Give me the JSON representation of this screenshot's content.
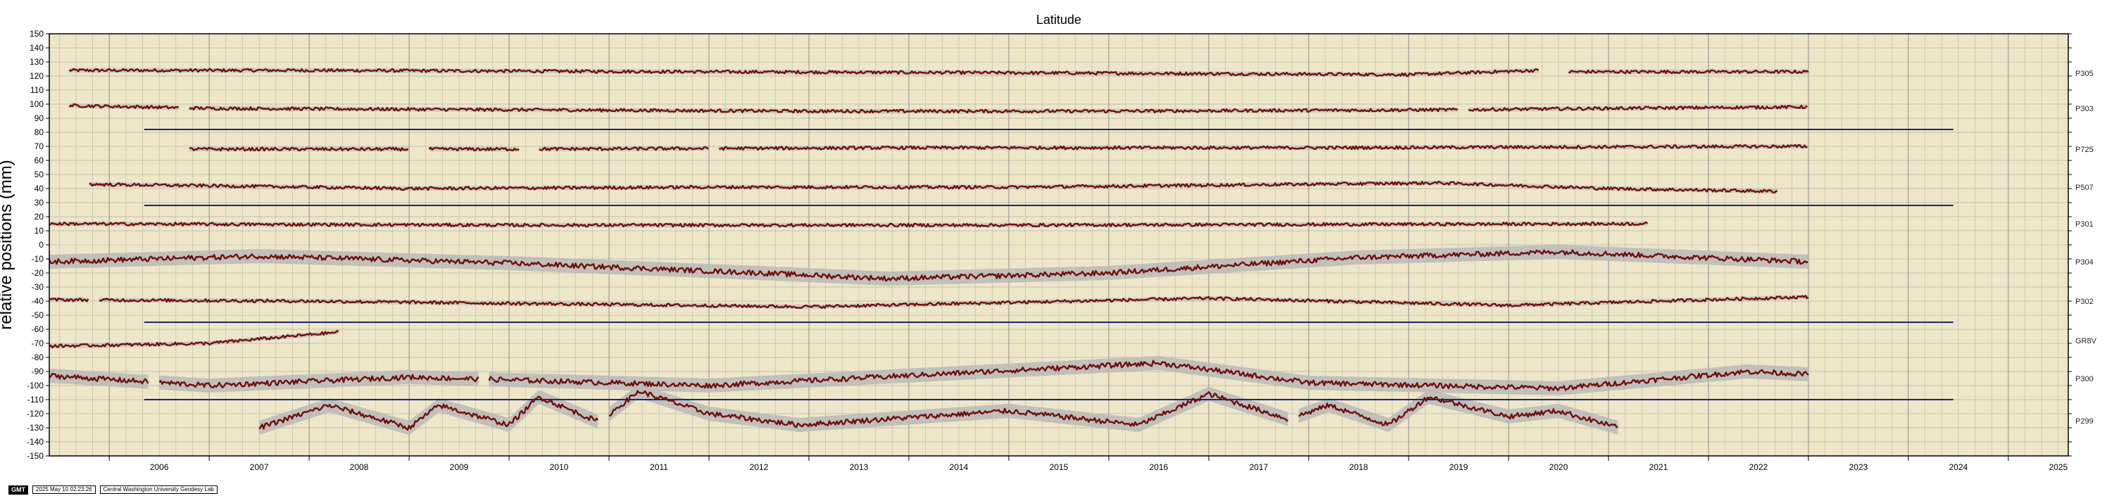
{
  "chart_data": {
    "type": "line",
    "title": "Latitude",
    "xlabel": "",
    "ylabel": "relative positions (mm)",
    "xlim": [
      2005.4,
      2025.6
    ],
    "ylim": [
      -150,
      150
    ],
    "yticks": [
      150,
      140,
      130,
      120,
      110,
      100,
      90,
      80,
      70,
      60,
      50,
      40,
      30,
      20,
      10,
      0,
      -10,
      -20,
      -30,
      -40,
      -50,
      -60,
      -70,
      -80,
      -90,
      -100,
      -110,
      -120,
      -130,
      -140,
      -150
    ],
    "xticks": [
      "2006",
      "2007",
      "2008",
      "2009",
      "2010",
      "2011",
      "2012",
      "2013",
      "2014",
      "2015",
      "2016",
      "2017",
      "2018",
      "2019",
      "2020",
      "2021",
      "2022",
      "2023",
      "2024",
      "2025"
    ],
    "grid": true,
    "colors": {
      "series": "#6e0f0f",
      "envelope": "#b9b9b9",
      "separator": "#1a237e",
      "background": "#ede6c9",
      "grid": "#6b6b6b"
    },
    "series": [
      {
        "name": "P305",
        "offset": 122,
        "start": 2005.6,
        "end": 2023.0,
        "gaps": [
          [
            2020.3,
            2020.6
          ]
        ],
        "values": [
          [
            2005.6,
            124
          ],
          [
            2008,
            124
          ],
          [
            2012,
            123
          ],
          [
            2016,
            122
          ],
          [
            2019,
            121
          ],
          [
            2020.3,
            124
          ],
          [
            2020.6,
            123
          ],
          [
            2023.0,
            123
          ]
        ]
      },
      {
        "name": "P303",
        "offset": 97,
        "start": 2005.6,
        "end": 2023.0,
        "gaps": [
          [
            2006.7,
            2006.8
          ],
          [
            2019.5,
            2019.6
          ]
        ],
        "values": [
          [
            2005.6,
            99
          ],
          [
            2007,
            97
          ],
          [
            2010,
            96
          ],
          [
            2013,
            95
          ],
          [
            2016,
            95
          ],
          [
            2019.5,
            96
          ],
          [
            2021,
            97
          ],
          [
            2023.0,
            98
          ]
        ]
      },
      {
        "name": "P725",
        "offset": 68,
        "start": 2006.8,
        "end": 2023.0,
        "gaps": [
          [
            2009.0,
            2009.2
          ],
          [
            2010.1,
            2010.3
          ],
          [
            2012.0,
            2012.1
          ]
        ],
        "values": [
          [
            2006.8,
            68
          ],
          [
            2010,
            68
          ],
          [
            2014,
            69
          ],
          [
            2018,
            69
          ],
          [
            2023.0,
            70
          ]
        ]
      },
      {
        "name": "P507",
        "offset": 41,
        "start": 2005.8,
        "end": 2022.7,
        "gaps": [],
        "values": [
          [
            2005.8,
            43
          ],
          [
            2007,
            42
          ],
          [
            2009,
            40
          ],
          [
            2012,
            41
          ],
          [
            2015,
            41
          ],
          [
            2019.3,
            44
          ],
          [
            2021,
            40
          ],
          [
            2022.7,
            38
          ]
        ]
      },
      {
        "name": "P301",
        "offset": 15,
        "start": 2005.4,
        "end": 2021.4,
        "gaps": [],
        "values": [
          [
            2005.4,
            15
          ],
          [
            2010,
            14
          ],
          [
            2015,
            14
          ],
          [
            2021.4,
            15
          ]
        ]
      },
      {
        "name": "P304",
        "offset": -12,
        "start": 2005.4,
        "end": 2023.0,
        "gaps": [],
        "values": [
          [
            2005.4,
            -12
          ],
          [
            2007.5,
            -8
          ],
          [
            2010,
            -13
          ],
          [
            2012.5,
            -20
          ],
          [
            2013.8,
            -24
          ],
          [
            2016,
            -20
          ],
          [
            2018.5,
            -9
          ],
          [
            2020.5,
            -5
          ],
          [
            2023.0,
            -12
          ]
        ]
      },
      {
        "name": "P302",
        "offset": -40,
        "start": 2005.4,
        "end": 2023.0,
        "gaps": [
          [
            2005.8,
            2005.9
          ]
        ],
        "values": [
          [
            2005.4,
            -39
          ],
          [
            2008,
            -40
          ],
          [
            2013,
            -44
          ],
          [
            2017,
            -38
          ],
          [
            2020,
            -43
          ],
          [
            2023.0,
            -37
          ]
        ]
      },
      {
        "name": "GR8V",
        "offset": -68,
        "start": 2005.4,
        "end": 2008.3,
        "gaps": [],
        "values": [
          [
            2005.4,
            -72
          ],
          [
            2007,
            -70
          ],
          [
            2008.3,
            -62
          ]
        ]
      },
      {
        "name": "P300",
        "offset": -95,
        "start": 2005.4,
        "end": 2023.0,
        "gaps": [
          [
            2006.4,
            2006.5
          ],
          [
            2009.7,
            2009.8
          ]
        ],
        "values": [
          [
            2005.4,
            -93
          ],
          [
            2007,
            -100
          ],
          [
            2009,
            -94
          ],
          [
            2012,
            -100
          ],
          [
            2016.5,
            -84
          ],
          [
            2018,
            -98
          ],
          [
            2020.5,
            -102
          ],
          [
            2022.4,
            -90
          ],
          [
            2023.0,
            -92
          ]
        ]
      },
      {
        "name": "P299",
        "offset": -125,
        "start": 2007.5,
        "end": 2021.1,
        "gaps": [
          [
            2010.9,
            2011.0
          ],
          [
            2017.8,
            2017.9
          ]
        ],
        "values": [
          [
            2007.5,
            -130
          ],
          [
            2008.2,
            -114
          ],
          [
            2009,
            -130
          ],
          [
            2009.3,
            -114
          ],
          [
            2010,
            -128
          ],
          [
            2010.3,
            -108
          ],
          [
            2010.9,
            -126
          ],
          [
            2011.3,
            -104
          ],
          [
            2012,
            -120
          ],
          [
            2012.9,
            -128
          ],
          [
            2015,
            -118
          ],
          [
            2016.3,
            -128
          ],
          [
            2017,
            -106
          ],
          [
            2017.8,
            -124
          ],
          [
            2018.2,
            -114
          ],
          [
            2018.8,
            -128
          ],
          [
            2019.2,
            -108
          ],
          [
            2020,
            -122
          ],
          [
            2020.5,
            -118
          ],
          [
            2021.1,
            -130
          ]
        ]
      }
    ],
    "separators": [
      82,
      28,
      -55,
      -110
    ],
    "separator_extent": [
      2006.35,
      2024.45
    ]
  },
  "footer": {
    "badge": "GMT",
    "timestamp": "2025 May 10 02:23:26",
    "lab": "Central Washington University Geodesy Lab"
  }
}
